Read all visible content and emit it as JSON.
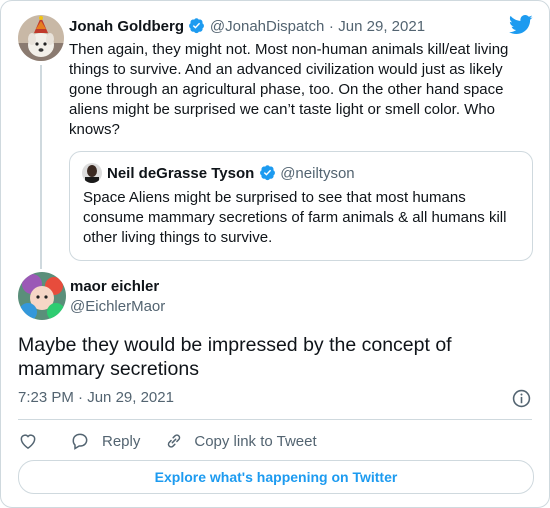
{
  "colors": {
    "accent": "#1d9bf0",
    "muted": "#536471",
    "border": "#cfd9de",
    "text": "#0f1419"
  },
  "icons": {
    "twitter": "twitter-bird-icon",
    "verified": "verified-badge-icon",
    "info": "info-icon",
    "like": "heart-icon",
    "reply": "reply-bubble-icon",
    "link": "link-icon"
  },
  "parent_tweet": {
    "author_name": "Jonah Goldberg",
    "author_handle": "@JonahDispatch",
    "separator": "·",
    "date": "Jun 29, 2021",
    "text": "Then again, they might not. Most non-human animals kill/eat living things to survive. And an advanced civilization would just as likely gone through an agricultural phase, too. On the other hand space aliens might be surprised we can’t taste light or smell color. Who knows?",
    "quote": {
      "author_name": "Neil deGrasse Tyson",
      "author_handle": "@neiltyson",
      "text": "Space Aliens might be surprised to see that most humans consume mammary secretions of farm animals & all humans kill other living things to survive."
    }
  },
  "main_tweet": {
    "author_name": "maor eichler",
    "author_handle": "@EichlerMaor",
    "text": "Maybe they would be impressed by the concept of mammary secretions",
    "time": "7:23 PM",
    "separator": "·",
    "date": "Jun 29, 2021"
  },
  "actions": {
    "reply_label": "Reply",
    "copy_link_label": "Copy link to Tweet"
  },
  "explore_label": "Explore what's happening on Twitter"
}
